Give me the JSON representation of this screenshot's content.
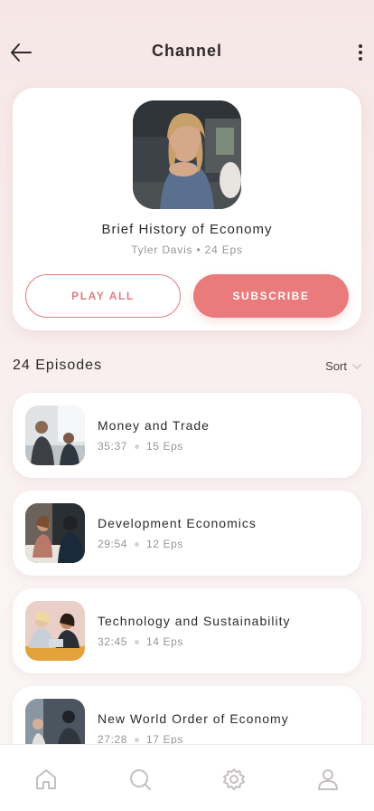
{
  "header": {
    "title": "Channel",
    "back_icon": "arrow-left-icon",
    "more_icon": "more-vertical-icon"
  },
  "channel": {
    "title": "Brief History of Economy",
    "author": "Tyler Davis",
    "episode_count": "24 Eps",
    "play_all_label": "PLAY ALL",
    "subscribe_label": "SUBSCRIBE"
  },
  "episodes": {
    "heading": "24 Episodes",
    "sort_label": "Sort",
    "items": [
      {
        "title": "Money and Trade",
        "duration": "35:37",
        "eps": "15 Eps"
      },
      {
        "title": "Development Economics",
        "duration": "29:54",
        "eps": "12 Eps"
      },
      {
        "title": "Technology and Sustainability",
        "duration": "32:45",
        "eps": "14 Eps"
      },
      {
        "title": "New World Order of Economy",
        "duration": "27:28",
        "eps": "17 Eps"
      }
    ]
  },
  "tabbar": {
    "tabs": [
      "home-icon",
      "search-icon",
      "settings-icon",
      "profile-icon"
    ]
  },
  "colors": {
    "accent": "#e97b7d",
    "text": "#2e2a2b",
    "muted": "#9a9495"
  }
}
